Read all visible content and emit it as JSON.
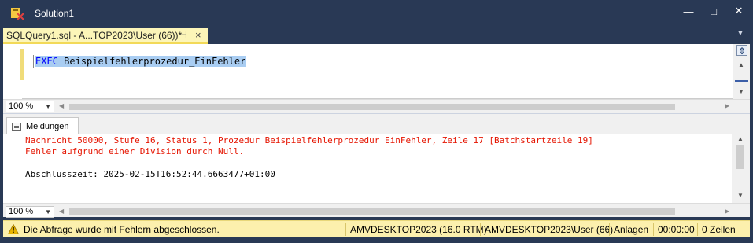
{
  "window": {
    "title": "Solution1",
    "minimize": "—",
    "maximize": "□",
    "close": "✕"
  },
  "tab": {
    "label": "SQLQuery1.sql - A...TOP2023\\User (66))*",
    "pin": "⊣",
    "close": "×"
  },
  "editor": {
    "keyword": "EXEC",
    "procedure": "Beispielfehlerprozedur_EinFehler"
  },
  "zoom": {
    "editor": "100 %",
    "results": "100 %"
  },
  "results": {
    "tab_label": "Meldungen",
    "lines": [
      {
        "text": "Nachricht 50000, Stufe 16, Status 1, Prozedur Beispielfehlerprozedur_EinFehler, Zeile 17 [Batchstartzeile 19]",
        "kind": "error"
      },
      {
        "text": "Fehler aufgrund einer Division durch Null.",
        "kind": "error"
      },
      {
        "text": "Abschlusszeit: 2025-02-15T16:52:44.6663477+01:00",
        "kind": "normal"
      }
    ]
  },
  "statusbar": {
    "message": "Die Abfrage wurde mit Fehlern abgeschlossen.",
    "server": "AMVDESKTOP2023 (16.0 RTM)",
    "user": "AMVDESKTOP2023\\User (66)",
    "database": "Anlagen",
    "elapsed": "00:00:00",
    "rows": "0 Zeilen"
  },
  "colors": {
    "chrome": "#293955",
    "active_tab": "#fcf5b8",
    "status_bar": "#fcf0ad",
    "error_text": "#e51400",
    "keyword": "#0000ff",
    "selection": "#a9cdf2"
  },
  "icons": [
    "app-icon",
    "pin-icon",
    "close-icon",
    "splitter-icon",
    "messages-icon",
    "warning-icon"
  ]
}
